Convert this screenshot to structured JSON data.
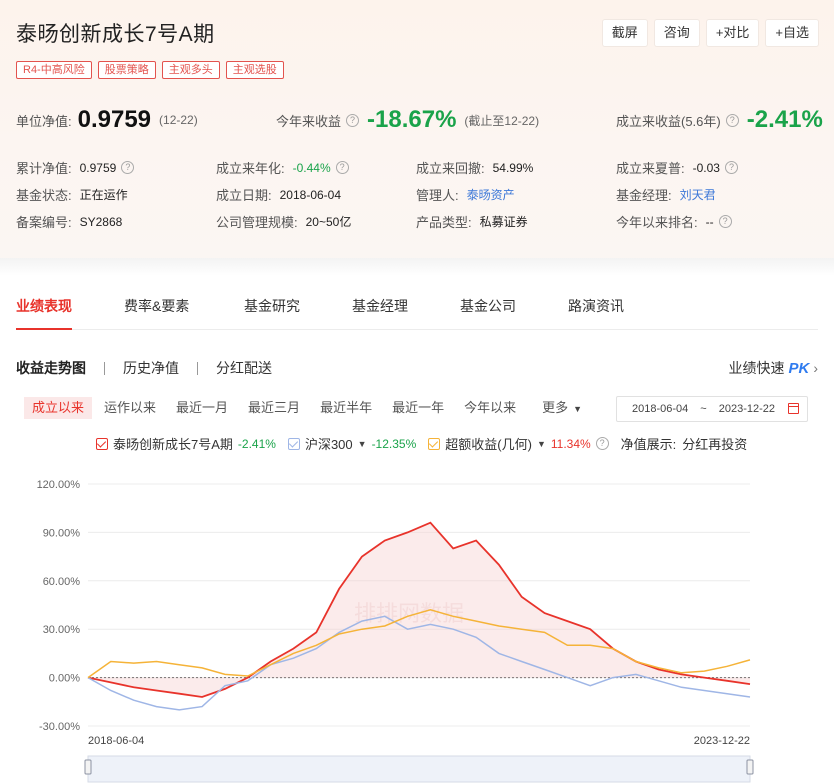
{
  "fund": {
    "title": "泰旸创新成长7号A期",
    "tags": [
      "R4-中高风险",
      "股票策略",
      "主观多头",
      "主观选股"
    ],
    "actions": [
      "截屏",
      "咨询",
      "+对比",
      "+自选"
    ]
  },
  "summary": {
    "nav_label": "单位净值:",
    "nav_value": "0.9759",
    "nav_date": "(12-22)",
    "ytd_label": "今年来收益",
    "ytd_value": "-18.67%",
    "ytd_since": "(截止至12-22)",
    "since_inception_label": "成立来收益(5.6年)",
    "since_inception_value": "-2.41%"
  },
  "details": {
    "rows": [
      [
        {
          "label": "累计净值:",
          "value": "0.9759",
          "help": true
        },
        {
          "label": "成立来年化:",
          "value": "-0.44%",
          "help": true,
          "style": "green"
        },
        {
          "label": "成立来回撤:",
          "value": "54.99%"
        },
        {
          "label": "成立来夏普:",
          "value": "-0.03",
          "help": true
        }
      ],
      [
        {
          "label": "基金状态:",
          "value": "正在运作"
        },
        {
          "label": "成立日期:",
          "value": "2018-06-04"
        },
        {
          "label": "管理人:",
          "value": "泰旸资产",
          "style": "link"
        },
        {
          "label": "基金经理:",
          "value": "刘天君",
          "style": "link"
        }
      ],
      [
        {
          "label": "备案编号:",
          "value": "SY2868"
        },
        {
          "label": "公司管理规模:",
          "value": "20~50亿"
        },
        {
          "label": "产品类型:",
          "value": "私募证券"
        },
        {
          "label": "今年以来排名:",
          "value": "--",
          "help": true
        }
      ]
    ]
  },
  "tabs": [
    "业绩表现",
    "费率&要素",
    "基金研究",
    "基金经理",
    "基金公司",
    "路演资讯"
  ],
  "subtabs": [
    "收益走势图",
    "历史净值",
    "分红配送"
  ],
  "quick": {
    "label": "业绩快速",
    "pk": "PK"
  },
  "ranges": [
    "成立以来",
    "运作以来",
    "最近一月",
    "最近三月",
    "最近半年",
    "最近一年",
    "今年以来",
    "更多"
  ],
  "date_range": {
    "start": "2018-06-04",
    "tilde": "~",
    "end": "2023-12-22"
  },
  "legend": {
    "fund_name": "泰旸创新成长7号A期",
    "fund_pct": "-2.41%",
    "index_name": "沪深300",
    "index_pct": "-12.35%",
    "excess_name": "超额收益(几何)",
    "excess_pct": "11.34%",
    "display_label": "净值展示:",
    "display_value": "分红再投资"
  },
  "colors": {
    "fund": "#e8332b",
    "index": "#9fb6e6",
    "excess": "#f5b338",
    "green": "#1aa34a",
    "link": "#3d78d8"
  },
  "chart_data": {
    "type": "line",
    "y_ticks": [
      "120.00%",
      "90.00%",
      "60.00%",
      "30.00%",
      "0.00%",
      "-30.00%"
    ],
    "x_labels": [
      "2018-06-04",
      "2023-12-22"
    ],
    "watermark": "排排网数据",
    "x_range": [
      "2018-06-04",
      "2023-12-22"
    ],
    "ylim": [
      -30,
      120
    ],
    "series": [
      {
        "name": "泰旸创新成长7号A期",
        "color": "#e8332b",
        "fill": true,
        "values": [
          0,
          -3,
          -6,
          -8,
          -10,
          -12,
          -7,
          0,
          10,
          18,
          28,
          55,
          75,
          85,
          90,
          96,
          80,
          85,
          70,
          50,
          40,
          35,
          30,
          18,
          10,
          5,
          2,
          0,
          -2,
          -4
        ]
      },
      {
        "name": "沪深300",
        "color": "#9fb6e6",
        "values": [
          0,
          -8,
          -14,
          -18,
          -20,
          -18,
          -5,
          -2,
          8,
          12,
          18,
          28,
          35,
          38,
          30,
          33,
          30,
          25,
          15,
          10,
          5,
          0,
          -5,
          0,
          2,
          -2,
          -6,
          -8,
          -10,
          -12
        ]
      },
      {
        "name": "超额收益(几何)",
        "color": "#f5b338",
        "values": [
          0,
          10,
          9,
          10,
          8,
          6,
          2,
          1,
          8,
          15,
          20,
          27,
          30,
          32,
          38,
          42,
          38,
          35,
          32,
          30,
          28,
          20,
          20,
          18,
          10,
          6,
          3,
          4,
          7,
          11
        ]
      }
    ]
  }
}
